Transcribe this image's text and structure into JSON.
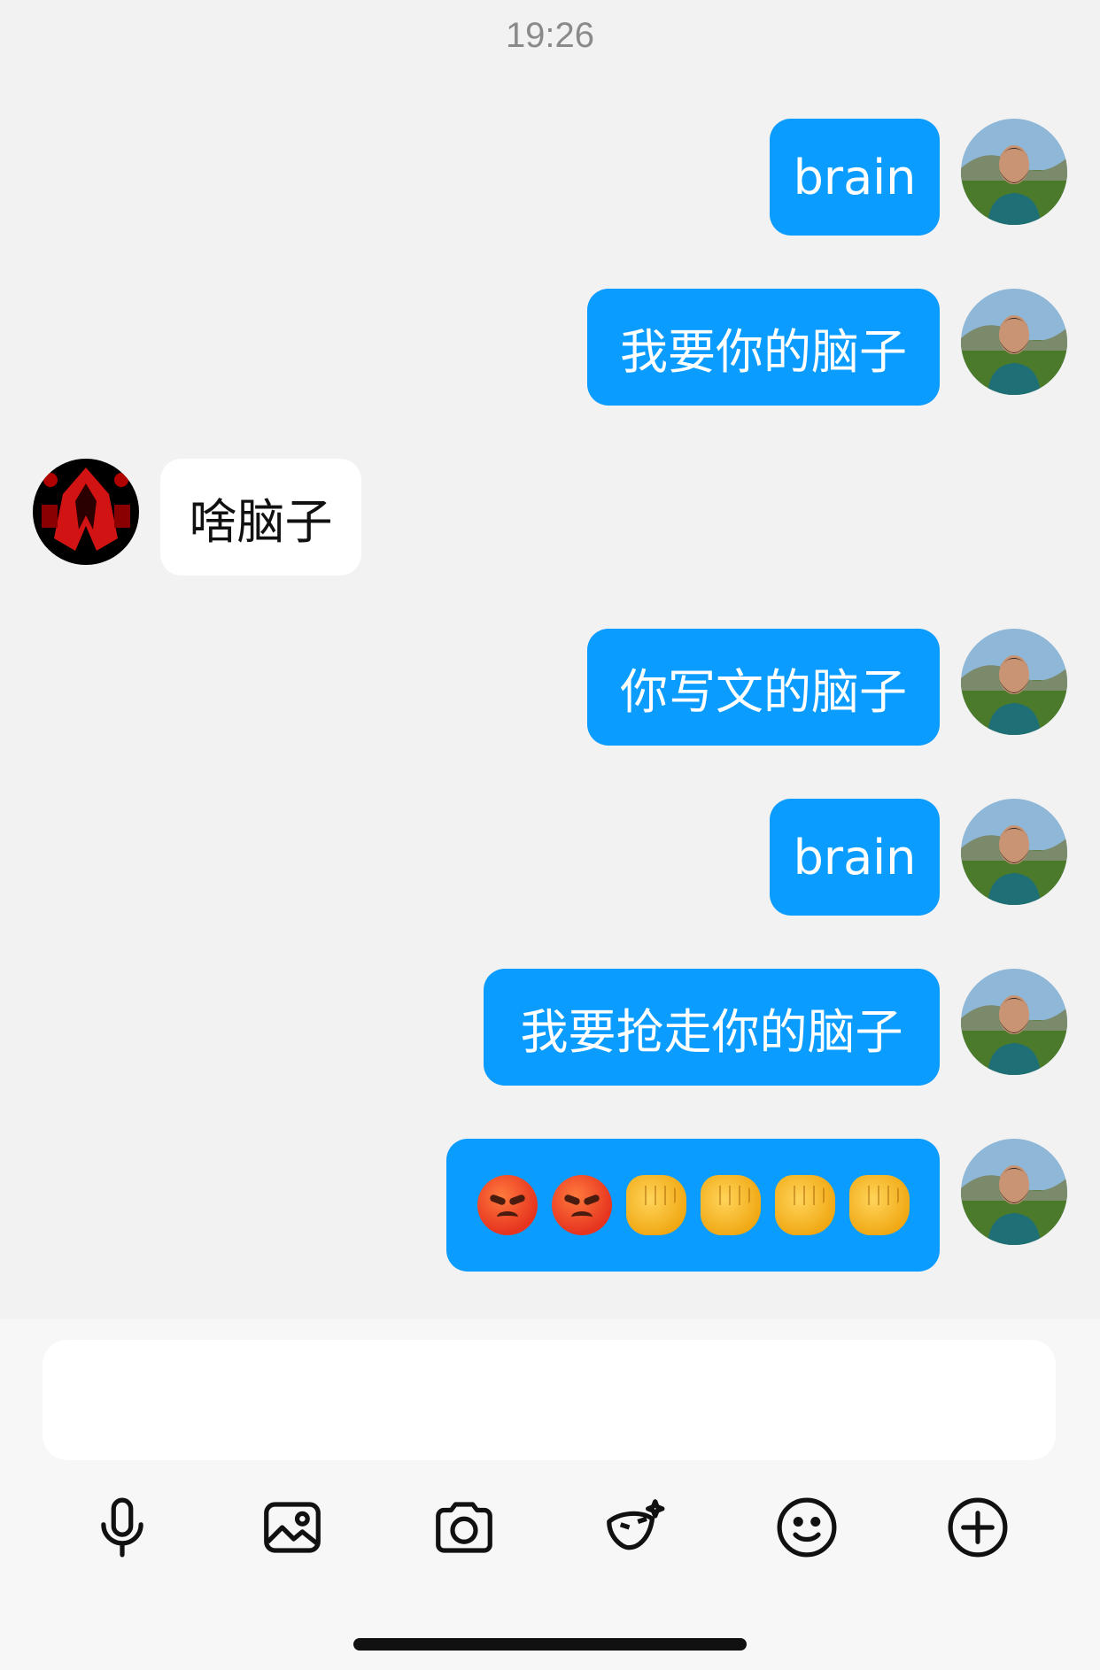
{
  "status_time": "19:26",
  "messages": [
    {
      "side": "out",
      "text": "brain"
    },
    {
      "side": "out",
      "text": "我要你的脑子"
    },
    {
      "side": "in",
      "text": "啥脑子"
    },
    {
      "side": "out",
      "text": "你写文的脑子"
    },
    {
      "side": "out",
      "text": "brain"
    },
    {
      "side": "out",
      "text": "我要抢走你的脑子"
    },
    {
      "side": "out",
      "emoji": [
        "angry-face",
        "angry-face",
        "oncoming-fist",
        "oncoming-fist",
        "oncoming-fist",
        "oncoming-fist"
      ]
    }
  ],
  "composer": {
    "placeholder": "",
    "toolbar": [
      "microphone-icon",
      "image-icon",
      "camera-icon",
      "ai-mask-icon",
      "smiley-icon",
      "plus-icon"
    ]
  },
  "colors": {
    "outgoing_bubble": "#0b9cff",
    "incoming_bubble": "#ffffff",
    "background": "#f2f2f2"
  }
}
